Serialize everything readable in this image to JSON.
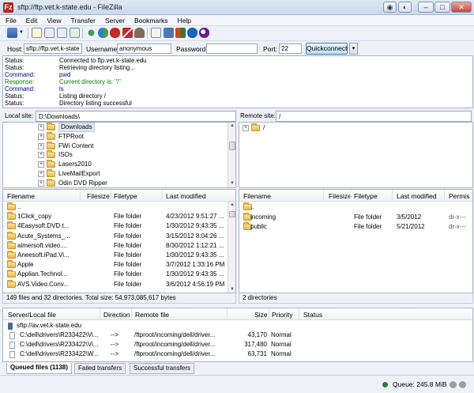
{
  "window": {
    "title": "sftp://ftp.vet.k-state.edu - FileZilla",
    "app_icon": "Fz",
    "controls": {
      "minimize": "–",
      "maximize": "□",
      "close": "✕",
      "extra1": "◉",
      "extra2": "◐"
    }
  },
  "menu": [
    "File",
    "Edit",
    "View",
    "Transfer",
    "Server",
    "Bookmarks",
    "Help"
  ],
  "quickconnect": {
    "host_label": "Host:",
    "host_value": "sftp://ftp.vet.k-state",
    "username_label": "Username:",
    "username_value": "anonymous",
    "password_label": "Password:",
    "password_value": "",
    "port_label": "Port:",
    "port_value": "22",
    "button_label": "Quickconnect",
    "dropdown_glyph": "▼"
  },
  "log": [
    {
      "kind": "Status:",
      "text": "Connected to ftp.vet.k-state.edu",
      "color": "#000000"
    },
    {
      "kind": "Status:",
      "text": "Retrieving directory listing...",
      "color": "#000000"
    },
    {
      "kind": "Command:",
      "text": "pwd",
      "color": "#00008b"
    },
    {
      "kind": "Response:",
      "text": "Current directory is: \"/\"",
      "color": "#008000"
    },
    {
      "kind": "Command:",
      "text": "ls",
      "color": "#00008b"
    },
    {
      "kind": "Status:",
      "text": "Listing directory /",
      "color": "#000000"
    },
    {
      "kind": "Status:",
      "text": "Directory listing successful",
      "color": "#000000"
    }
  ],
  "local": {
    "site_label": "Local site:",
    "site_path": "D:\\Downloads\\",
    "tree": [
      "Downloads",
      "FTPRoot",
      "FWi Content",
      "ISOs",
      "Lasers2010",
      "LiveMailExport",
      "Odin DVD Ripper"
    ],
    "columns": [
      "Filename",
      "Filesize",
      "Filetype",
      "Last modified"
    ],
    "files": [
      {
        "name": "..",
        "type": "",
        "modified": ""
      },
      {
        "name": "1Click_copy",
        "type": "File folder",
        "modified": "4/23/2012 9:51:27 ..."
      },
      {
        "name": "4Easysoft.DVD.t...",
        "type": "File folder",
        "modified": "1/30/2012 9:43:35 ..."
      },
      {
        "name": "Acute_Systems_...",
        "type": "File folder",
        "modified": "3/15/2012 8:04:26 ..."
      },
      {
        "name": "aimersoft.video....",
        "type": "File folder",
        "modified": "8/30/2012 1:12:21 ..."
      },
      {
        "name": "Aneesoft.iPad.Vi...",
        "type": "File folder",
        "modified": "1/30/2012 9:43:35 ..."
      },
      {
        "name": "Apple",
        "type": "File folder",
        "modified": "3/7/2012 1:33:16 PM"
      },
      {
        "name": "Applian.Technol...",
        "type": "File folder",
        "modified": "1/30/2012 9:43:35 ..."
      },
      {
        "name": "AVS.Video.Conv...",
        "type": "File folder",
        "modified": "3/6/2012 4:56:19 PM"
      }
    ],
    "status": "149 files and 32 directories. Total size: 54,973,085,617 bytes"
  },
  "remote": {
    "site_label": "Remote site:",
    "site_path": "/",
    "tree": [
      "/"
    ],
    "columns": [
      "Filename",
      "Filesize",
      "Filetype",
      "Last modified",
      "Permis"
    ],
    "files": [
      {
        "name": "..",
        "type": "",
        "modified": "",
        "perm": ""
      },
      {
        "name": "incoming",
        "type": "File folder",
        "modified": "3/5/2012",
        "perm": "dr-x---"
      },
      {
        "name": "public",
        "type": "File folder",
        "modified": "5/21/2012",
        "perm": "dr-x---"
      }
    ],
    "status": "2 directories"
  },
  "queue": {
    "columns": [
      "Server/Local file",
      "Direction",
      "Remote file",
      "Size",
      "Priority",
      "Status"
    ],
    "server": "sftp://av.vet.k-state.edu",
    "items": [
      {
        "local": "C:\\dell\\drivers\\R233422\\Vi...",
        "dir": "-->",
        "remote": "/ftproot/incoming/dell/driver...",
        "size": "43,170",
        "priority": "Normal"
      },
      {
        "local": "C:\\dell\\drivers\\R233422\\Vi...",
        "dir": "-->",
        "remote": "/ftproot/incoming/dell/driver...",
        "size": "317,480",
        "priority": "Normal"
      },
      {
        "local": "C:\\dell\\drivers\\R233422\\W...",
        "dir": "-->",
        "remote": "/ftproot/incoming/dell/driver...",
        "size": "63,731",
        "priority": "Normal"
      }
    ],
    "tabs": [
      "Queued files (1138)",
      "Failed transfers",
      "Successful transfers"
    ]
  },
  "statusbar": {
    "queue_text": "Queue: 245.8 MiB"
  },
  "icons": {
    "folder": "folder-icon",
    "toolbar": [
      "site-manager-icon",
      "toggle-log-icon",
      "toggle-local-tree-icon",
      "toggle-remote-tree-icon",
      "toggle-queue-icon",
      "refresh-icon",
      "process-queue-icon",
      "cancel-icon",
      "disconnect-icon",
      "reconnect-icon",
      "view-hidden-icon",
      "filter-icon",
      "compare-icon",
      "sync-browse-icon",
      "search-icon"
    ]
  }
}
